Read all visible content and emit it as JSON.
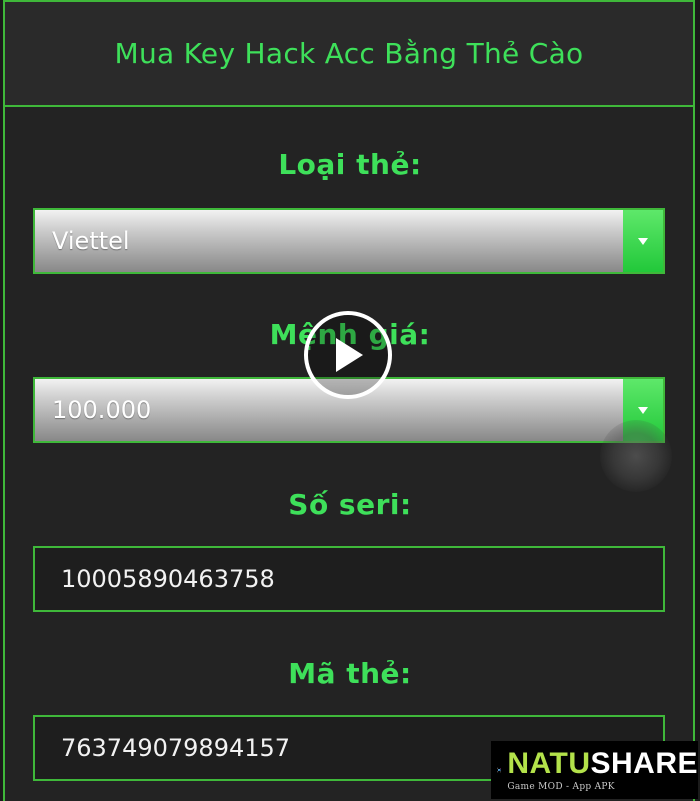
{
  "header": {
    "title": "Mua Key Hack Acc Bằng Thẻ Cào"
  },
  "form": {
    "card_type": {
      "label": "Loại thẻ:",
      "value": "Viettel"
    },
    "denomination": {
      "label": "Mệnh giá:",
      "value": "100.000"
    },
    "serial": {
      "label": "Số seri:",
      "value": "10005890463758"
    },
    "card_code": {
      "label": "Mã thẻ:",
      "value": "763749079894157"
    }
  },
  "video": {
    "icon": "play-icon"
  },
  "watermark": {
    "name_part1": "NATU",
    "name_part2": "SHARE",
    "tagline": "Game MOD - App APK"
  },
  "colors": {
    "accent": "#3ee05a",
    "border": "#3fb83a",
    "background": "#232323"
  }
}
